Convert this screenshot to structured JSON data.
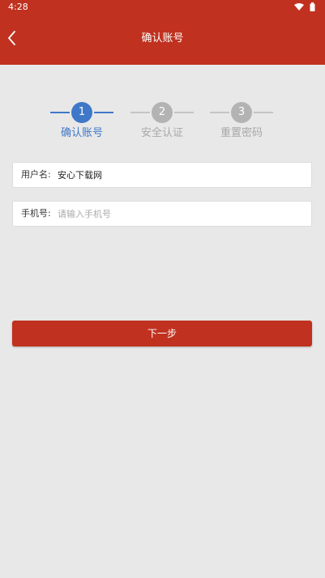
{
  "status_bar": {
    "time": "4:28",
    "icons": [
      "wifi-icon",
      "battery-icon"
    ]
  },
  "header": {
    "title": "确认账号",
    "back_icon": "chevron-left-icon"
  },
  "stepper": {
    "active_step": 1,
    "steps": [
      {
        "number": "1",
        "label": "确认账号"
      },
      {
        "number": "2",
        "label": "安全认证"
      },
      {
        "number": "3",
        "label": "重置密码"
      }
    ]
  },
  "form": {
    "username": {
      "label": "用户名:",
      "value": "安心下载网"
    },
    "phone": {
      "label": "手机号:",
      "placeholder": "请输入手机号",
      "value": ""
    }
  },
  "actions": {
    "next_label": "下一步"
  },
  "colors": {
    "brand": "#c0311f",
    "active_step": "#3f78c8",
    "inactive_step": "#b3b3b3",
    "background": "#e8e8e8"
  }
}
